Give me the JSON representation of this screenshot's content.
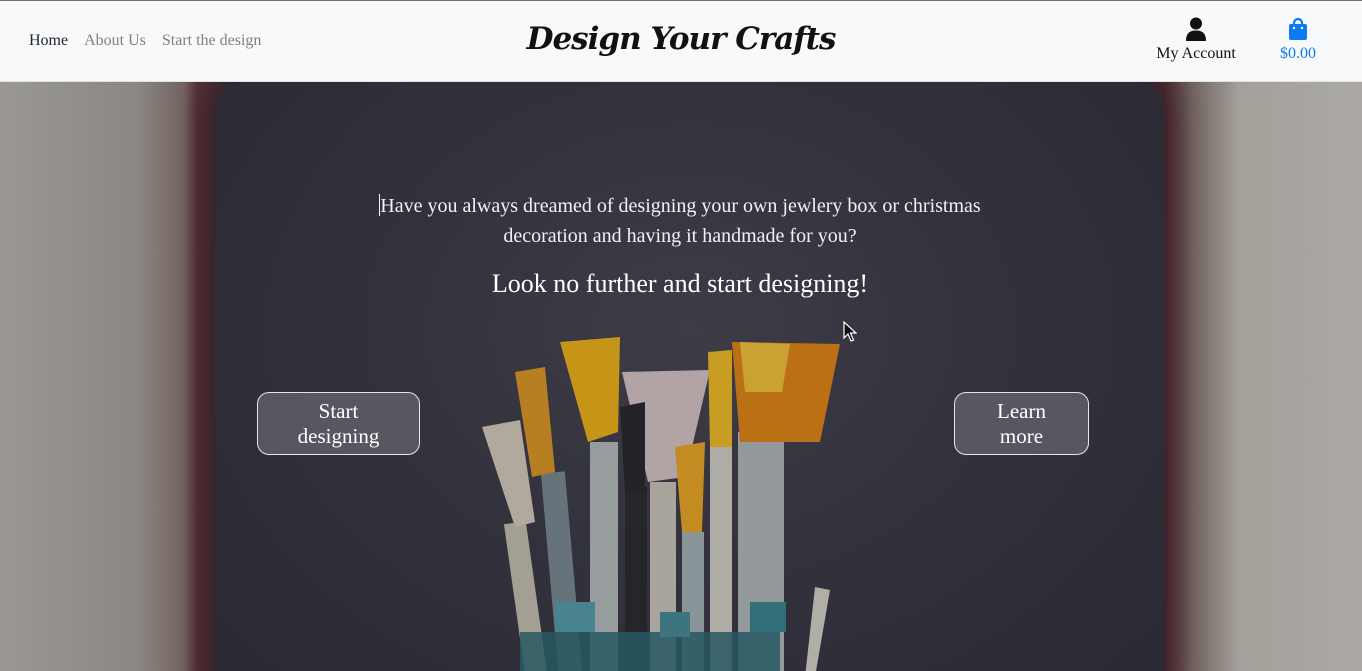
{
  "nav": {
    "links": [
      "Home",
      "About Us",
      "Start the design"
    ],
    "brand": "Design Your Crafts",
    "account_label": "My Account",
    "account_icon": "user-icon",
    "cart_total": "$0.00",
    "cart_icon": "shopping-bag-icon",
    "cart_color": "#0d7bf0"
  },
  "hero": {
    "intro_line1": "Have you always dreamed of designing your own jewlery box or christmas",
    "intro_line2": "decoration and having it handmade for you?",
    "tagline": "Look no further and start designing!",
    "start_button": "Start designing",
    "learn_button": "Learn more"
  }
}
